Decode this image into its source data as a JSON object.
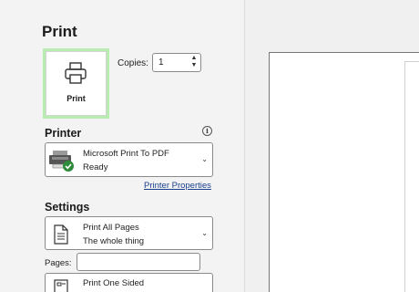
{
  "title": "Print",
  "print_button": {
    "label": "Print",
    "icon": "printer-icon"
  },
  "copies": {
    "label": "Copies:",
    "value": "1"
  },
  "printer": {
    "heading": "Printer",
    "name": "Microsoft Print To PDF",
    "status": "Ready",
    "properties_link": "Printer Properties"
  },
  "settings": {
    "heading": "Settings",
    "pages_option": {
      "line1": "Print All Pages",
      "line2": "The whole thing"
    },
    "pages_label": "Pages:",
    "pages_value": "",
    "sides_option": {
      "line1": "Print One Sided"
    }
  },
  "colors": {
    "print_button_highlight": "#b8ecb0",
    "link": "#1a3f8f",
    "ready_check": "#2e8b3a"
  }
}
